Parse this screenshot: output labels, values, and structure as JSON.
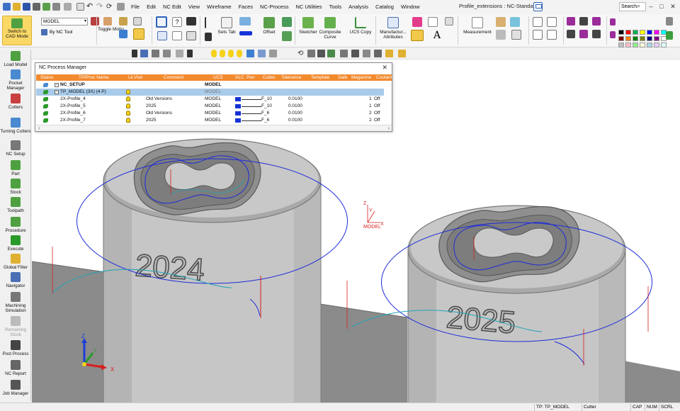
{
  "title_bar": {
    "menus": [
      "File",
      "Edit",
      "NC Edit",
      "View",
      "Wireframe",
      "Faces",
      "NC-Process",
      "NC Utilities",
      "Tools",
      "Analysis",
      "Catalog",
      "Window"
    ],
    "window_title": "Profile_extensions : NC-Standard",
    "search_placeholder": "Search"
  },
  "ribbon": {
    "switch_to_cad": "Switch to CAD Mode",
    "model_selector": "MODEL",
    "by_nc_tool": "By NC Tool",
    "toggle_motion": "Toggle Motio...",
    "sets_tab": "Sets Tab",
    "offset": "Offset",
    "sketcher": "Sketcher",
    "composite_curve": "Composite Curve",
    "ucs_copy": "UCS Copy",
    "manufacturing_attributes": "Manufactur... Attributes",
    "measurement": "Measurement",
    "palette_colors": [
      "#000000",
      "#ff0000",
      "#00b050",
      "#ffff00",
      "#0000ff",
      "#ff00ff",
      "#00ffff",
      "#800000",
      "#ff8000",
      "#008000",
      "#808000",
      "#000080",
      "#800080",
      "#ffffff",
      "#c0c0c0",
      "#ffc0cb",
      "#90ee90",
      "#ffffe0",
      "#add8e6",
      "#e6ccff",
      "#e0ffff"
    ]
  },
  "sidebar": {
    "items": [
      {
        "label": "Load Model",
        "icon": "load-model-icon",
        "enabled": true
      },
      {
        "label": "Pocket Manager",
        "icon": "pocket-manager-icon",
        "enabled": true
      },
      {
        "label": "Cutters",
        "icon": "cutters-icon",
        "enabled": true
      },
      {
        "label": "Turning Cutters",
        "icon": "turning-cutters-icon",
        "enabled": true
      },
      {
        "label": "NC Setup",
        "icon": "nc-setup-icon",
        "enabled": true
      },
      {
        "label": "Part",
        "icon": "part-icon",
        "enabled": true
      },
      {
        "label": "Stock",
        "icon": "stock-icon",
        "enabled": true
      },
      {
        "label": "Toolpath",
        "icon": "toolpath-icon",
        "enabled": true
      },
      {
        "label": "Procedure",
        "icon": "procedure-icon",
        "enabled": true
      },
      {
        "label": "Execute",
        "icon": "execute-icon",
        "enabled": true
      },
      {
        "label": "Global Filter",
        "icon": "global-filter-icon",
        "enabled": true
      },
      {
        "label": "Navigator",
        "icon": "navigator-icon",
        "enabled": true
      },
      {
        "label": "Machining Simulation",
        "icon": "machining-simulation-icon",
        "enabled": true
      },
      {
        "label": "Remaining Stock",
        "icon": "remaining-stock-icon",
        "enabled": false
      },
      {
        "label": "Post Process",
        "icon": "post-process-icon",
        "enabled": true
      },
      {
        "label": "NC Report",
        "icon": "nc-report-icon",
        "enabled": true
      },
      {
        "label": "Job Manager",
        "icon": "job-manager-icon",
        "enabled": true
      }
    ]
  },
  "process_manager": {
    "title": "NC Process Manager",
    "columns": [
      "Status",
      "TP/Proc Name",
      "Lk",
      "Visit",
      "Comment",
      "UCS",
      "XLC",
      "Pen",
      "Cutter",
      "Tolerance",
      "Template",
      "Safe",
      "Magazine",
      "Coolant"
    ],
    "setup_row": {
      "name": "NC_SETUP",
      "ucs": "MODEL"
    },
    "toolpath_row": {
      "name": "TP_MODEL (3X) (4 P)",
      "ucs": "MODEL"
    },
    "procedures": [
      {
        "name": "2X-Profile_4",
        "comment": "Old Versions",
        "ucs": "MODEL",
        "cutter": "F_10",
        "tolerance": "0.0100",
        "magazine": "1",
        "coolant": "Off"
      },
      {
        "name": "2X-Profile_5",
        "comment": "2025",
        "ucs": "MODEL",
        "cutter": "F_10",
        "tolerance": "0.0100",
        "magazine": "1",
        "coolant": "Off"
      },
      {
        "name": "2X-Profile_6",
        "comment": "Old Versions",
        "ucs": "MODEL",
        "cutter": "F_6",
        "tolerance": "0.0100",
        "magazine": "2",
        "coolant": "Off"
      },
      {
        "name": "2X-Profile_7",
        "comment": "2025",
        "ucs": "MODEL",
        "cutter": "F_6",
        "tolerance": "0.0100",
        "magazine": "2",
        "coolant": "Off"
      }
    ],
    "header_color": "#f28a2e",
    "selected_row_color": "#a9cbea",
    "pen_color": "#1533d8"
  },
  "viewport": {
    "part_labels": [
      "2024",
      "2025"
    ],
    "ucs_label": "MODEL",
    "axes": {
      "x": "X",
      "y": "Y",
      "z": "Z"
    },
    "colors": {
      "part": "#c9c9c9",
      "toolpath_blue": "#1e2bd8",
      "toolpath_cyan": "#22a3b8",
      "toolpath_red": "#d81e1e",
      "floor": "#8a8a8a"
    }
  },
  "status_bar": {
    "toolpath": "TP: TP_MODEL",
    "entity": "Cutter",
    "indicators": [
      "CAP",
      "NUM",
      "SCRL"
    ]
  }
}
